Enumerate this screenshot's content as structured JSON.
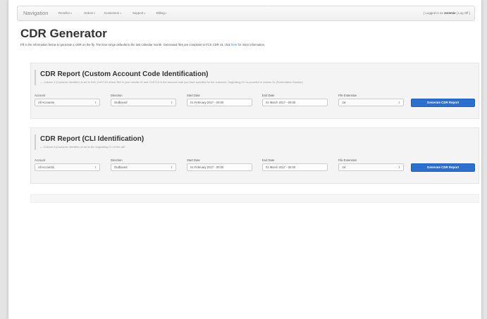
{
  "navbar": {
    "brand": "Navigation",
    "items": [
      {
        "label": "Reseller",
        "dropdown": true
      },
      {
        "label": "Orders",
        "dropdown": true
      },
      {
        "label": "Customers",
        "dropdown": true
      },
      {
        "label": "Support",
        "dropdown": true
      },
      {
        "label": "Billing",
        "dropdown": true
      }
    ],
    "login_prefix": "[ Logged in as",
    "username": "Jeremie",
    "logoff_link": "Log Off",
    "login_suffix": "]"
  },
  "page": {
    "title": "CDR Generator",
    "intro_text": "Fill in the information below to generate a CDR on the fly. The time range defaults to the last calendar month. Generated files are compliant to FCS CDR v3, click",
    "intro_link": "here",
    "intro_tail": "for more information."
  },
  "labels": {
    "account": "Account",
    "direction": "Direction",
    "start_date": "Start Date",
    "end_date": "End Date",
    "file_extension": "File Extension"
  },
  "reports": [
    {
      "title": "CDR Report (Custom Account Code Identification)",
      "description": "— Column 3 (Customer Identifier) is set to INO_CUST1D where INO is your reseller ID and CUST1D is the account code you have specified for the customer. Originating CLI is provided in column 31 (Presentation Number)",
      "account": "All Accounts",
      "direction": "Outbound",
      "start_date": "01 February 2017 - 00:00",
      "end_date": "01 March 2017 - 00:00",
      "file_extension": ".txt",
      "button_label": "Generate CDR Report"
    },
    {
      "title": "CDR Report (CLI Identification)",
      "description": "— Column 3 (Customer Identifier) is set to the originating CLI of the call.",
      "account": "All Accounts",
      "direction": "Outbound",
      "start_date": "01 February 2017 - 00:00",
      "end_date": "01 March 2017 - 00:00",
      "file_extension": ".txt",
      "button_label": "Generate CDR Report"
    }
  ],
  "icons": {
    "dropdown_caret": "caret-down-icon",
    "select_arrows": "select-arrows-icon"
  },
  "colors": {
    "primary_button": "#2a6fd1",
    "link": "#3a7ac4",
    "panel_background": "#f4f4f4"
  }
}
